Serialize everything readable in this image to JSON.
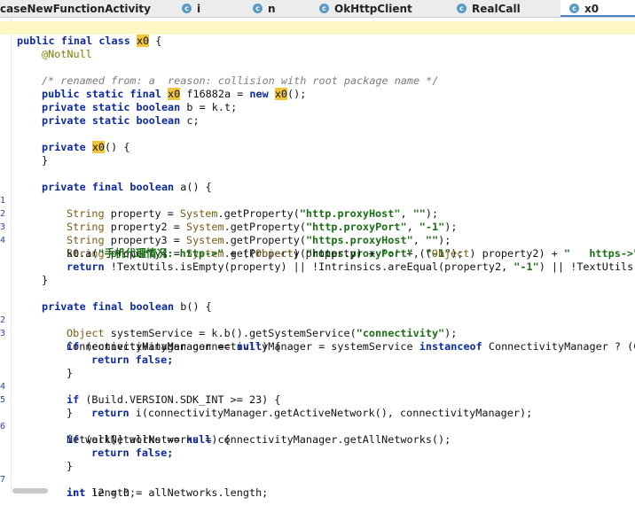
{
  "tabs": [
    {
      "label": "caseNewFunctionActivity",
      "icon": ""
    },
    {
      "label": "i",
      "icon": "c"
    },
    {
      "label": "n",
      "icon": "c"
    },
    {
      "label": "OkHttpClient",
      "icon": "c"
    },
    {
      "label": "RealCall",
      "icon": "c"
    },
    {
      "label": "x0",
      "icon": "c"
    }
  ],
  "code": {
    "l1_kw": "public final class ",
    "l1_cls": "x0",
    "l1_rest": " {",
    "l2": "@NotNull",
    "l4": "/* renamed from: a  reason: collision with root package name */",
    "l5_a": "public static final ",
    "l5_cls": "x0",
    "l5_b": " f16882a = ",
    "l5_new": "new ",
    "l5_cls2": "x0",
    "l5_c": "();",
    "l6_a": "private static boolean ",
    "l6_b": "b = k.t;",
    "l7_a": "private static boolean ",
    "l7_b": "c;",
    "l9_a": "private ",
    "l9_cls": "x0",
    "l9_b": "() {",
    "l10": "}",
    "l12_a": "private final boolean ",
    "l12_b": "a() {",
    "l13_ln": "1",
    "l13_ty": "String",
    "l13_a": " property = ",
    "l13_sys": "System",
    "l13_b": ".getProperty(",
    "l13_s1": "\"http.proxyHost\"",
    "l13_c": ", ",
    "l13_s2": "\"\"",
    "l13_d": ");",
    "l14_ln": "2",
    "l14_ty": "String",
    "l14_a": " property2 = ",
    "l14_sys": "System",
    "l14_b": ".getProperty(",
    "l14_s1": "\"http.proxyPort\"",
    "l14_c": ", ",
    "l14_s2": "\"-1\"",
    "l14_d": ");",
    "l15_ln": "3",
    "l15_ty": "String",
    "l15_a": " property3 = ",
    "l15_sys": "System",
    "l15_b": ".getProperty(",
    "l15_s1": "\"https.proxyHost\"",
    "l15_c": ", ",
    "l15_s2": "\"\"",
    "l15_d": ");",
    "l16_ln": "4",
    "l16_ty": "String",
    "l16_a": " property4 = ",
    "l16_sys": "System",
    "l16_b": ".getProperty(",
    "l16_s1": "\"https.proxyPort\"",
    "l16_c": ", ",
    "l16_s2": "\"-1\"",
    "l16_d": ");",
    "l17_a": "k0.a(",
    "l17_s1": "\"手机代理情况: http->\"",
    "l17_b": " + ((",
    "l17_ty1": "Object",
    "l17_c": ") property) + ",
    "l17_s2": "':'",
    "l17_d": " + ((",
    "l17_ty2": "Object",
    "l17_e": ") property2) + ",
    "l17_s3": "\"   https->\"",
    "l18_kw": "return ",
    "l18_a": "!TextUtils.isEmpty(property) || !Intrinsics.areEqual(property2, ",
    "l18_s": "\"-1\"",
    "l18_b": ") || !TextUtils.i",
    "l19": "}",
    "l21_a": "private final boolean ",
    "l21_b": "b() {",
    "l22_ln": "2",
    "l22_ty": "Object",
    "l22_a": " systemService = k.b().getSystemService(",
    "l22_s": "\"connectivity\"",
    "l22_b": ");",
    "l23_ln": "3",
    "l23_a": "ConnectivityManager connectivityManager = systemService ",
    "l23_kw": "instanceof",
    "l23_b": " ConnectivityManager ? (Co",
    "l24_kw": "if ",
    "l24_a": "(connectivityManager == ",
    "l24_null": "null",
    "l24_b": ") {",
    "l25_kw": "return false;",
    "l26": "}",
    "l27_ln": "4",
    "l27_kw": "if ",
    "l27_a": "(Build.VERSION.SDK_INT >= 23) {",
    "l28_ln": "5",
    "l28_kw": "return ",
    "l28_a": "i(connectivityManager.getActiveNetwork(), connectivityManager);",
    "l29": "}",
    "l30_ln": "6",
    "l30_a": "Network[] allNetworks = connectivityManager.getAllNetworks();",
    "l31_kw": "if ",
    "l31_a": "(allNetworks == ",
    "l31_null": "null",
    "l31_b": ") {",
    "l32_kw": "return false;",
    "l33": "}",
    "l34_ln": "7",
    "l34_kw": "int ",
    "l34_a": "length = allNetworks.length;",
    "l35_kw": "int ",
    "l35_a": "i2 = 0;"
  },
  "colors": {
    "keyword": "#0c2aa0",
    "string": "#1a6e13",
    "type": "#7a5b14",
    "highlight": "#f0c63a",
    "line_number": "#2846a8"
  }
}
